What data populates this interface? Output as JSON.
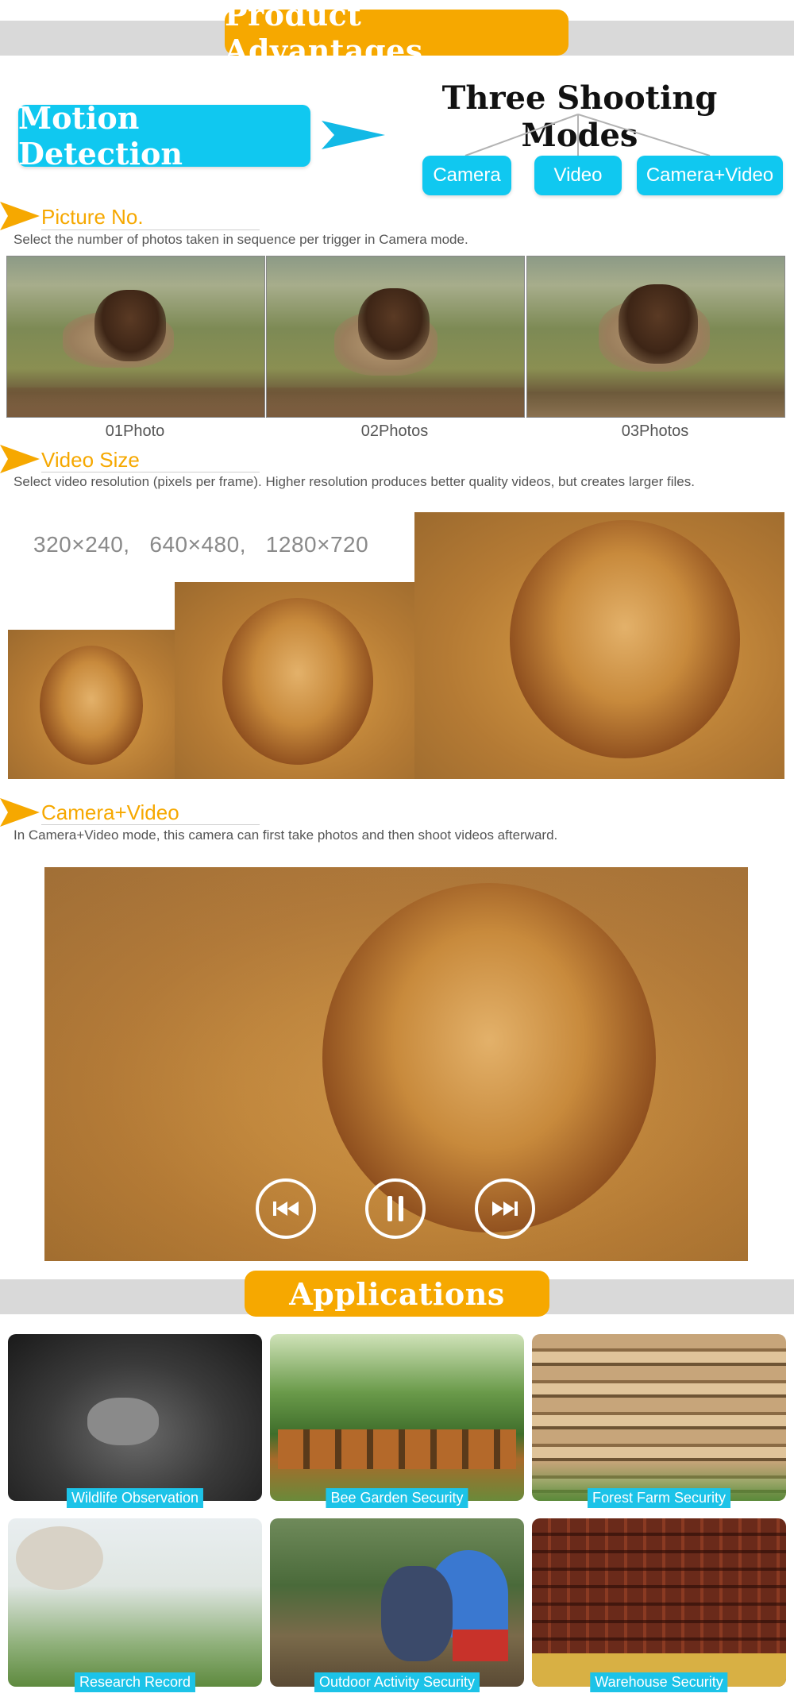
{
  "header": {
    "title": "Product Advantages"
  },
  "motion": {
    "label": "Motion Detection"
  },
  "modes": {
    "title": "Three Shooting Modes",
    "items": [
      "Camera",
      "Video",
      "Camera+Video"
    ]
  },
  "picture_no": {
    "title": "Picture No.",
    "description": "Select the number of photos taken in sequence per trigger in Camera mode.",
    "captions": [
      "01Photo",
      "02Photos",
      "03Photos"
    ]
  },
  "video_size": {
    "title": "Video Size",
    "description": "Select video resolution (pixels per frame). Higher resolution produces better quality videos, but creates larger files.",
    "resolutions": "320×240,   640×480,   1280×720"
  },
  "camera_video": {
    "title": "Camera+Video",
    "description": "In Camera+Video mode, this camera can first take photos and then shoot videos afterward."
  },
  "applications": {
    "title": "Applications",
    "items": [
      "Wildlife Observation",
      "Bee Garden Security",
      "Forest Farm Security",
      "Research Record",
      "Outdoor Activity Security",
      "Warehouse Security"
    ]
  },
  "colors": {
    "accent_orange": "#f6a800",
    "accent_cyan": "#10c8f0",
    "band_gray": "#d9d9d9"
  },
  "icons": [
    "arrow-right-icon",
    "section-arrow-icon",
    "rewind-icon",
    "pause-icon",
    "fast-forward-icon"
  ]
}
